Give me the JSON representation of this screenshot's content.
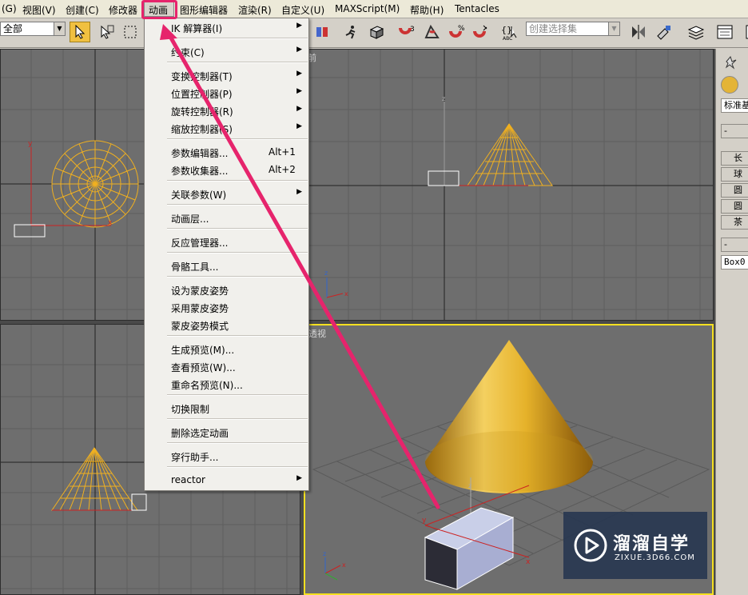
{
  "menubar": {
    "items": [
      "(G)",
      "视图(V)",
      "创建(C)",
      "修改器",
      "动画",
      "图形编辑器",
      "渲染(R)",
      "自定义(U)",
      "MAXScript(M)",
      "帮助(H)",
      "Tentacles"
    ]
  },
  "toolbar": {
    "filter_value": "全部",
    "named_selection_placeholder": "创建选择集"
  },
  "animation_menu": {
    "items": [
      {
        "label": "IK 解算器(I)",
        "shortcut": "",
        "submenu": true
      },
      {
        "label": "约束(C)",
        "shortcut": "",
        "submenu": true
      },
      {
        "label": "变换控制器(T)",
        "shortcut": "",
        "submenu": true
      },
      {
        "label": "位置控制器(P)",
        "shortcut": "",
        "submenu": true
      },
      {
        "label": "旋转控制器(R)",
        "shortcut": "",
        "submenu": true
      },
      {
        "label": "缩放控制器(S)",
        "shortcut": "",
        "submenu": true
      },
      {
        "label": "参数编辑器...",
        "shortcut": "Alt+1",
        "submenu": false
      },
      {
        "label": "参数收集器...",
        "shortcut": "Alt+2",
        "submenu": false
      },
      {
        "label": "关联参数(W)",
        "shortcut": "",
        "submenu": true
      },
      {
        "label": "动画层...",
        "shortcut": "",
        "submenu": false
      },
      {
        "label": "反应管理器...",
        "shortcut": "",
        "submenu": false
      },
      {
        "label": "骨骼工具...",
        "shortcut": "",
        "submenu": false
      },
      {
        "label": "设为蒙皮姿势",
        "shortcut": "",
        "submenu": false
      },
      {
        "label": "采用蒙皮姿势",
        "shortcut": "",
        "submenu": false
      },
      {
        "label": "蒙皮姿势模式",
        "shortcut": "",
        "submenu": false
      },
      {
        "label": "生成预览(M)...",
        "shortcut": "",
        "submenu": false
      },
      {
        "label": "查看预览(W)...",
        "shortcut": "",
        "submenu": false
      },
      {
        "label": "重命名预览(N)...",
        "shortcut": "",
        "submenu": false
      },
      {
        "label": "切换限制",
        "shortcut": "",
        "submenu": false
      },
      {
        "label": "删除选定动画",
        "shortcut": "",
        "submenu": false
      },
      {
        "label": "穿行助手...",
        "shortcut": "",
        "submenu": false
      },
      {
        "label": "reactor",
        "shortcut": "",
        "submenu": true
      }
    ]
  },
  "viewports": {
    "front_label": "前",
    "perspective_label": "透视"
  },
  "command_panel": {
    "dropdown": "标准基",
    "buttons": [
      "长",
      "球",
      "圆",
      "圆",
      "茶"
    ],
    "name_field": "Box0",
    "rollout_minus": "-"
  },
  "watermark": {
    "title": "溜溜自学",
    "url": "ZIXUE.3D66.COM"
  },
  "colors": {
    "wireframe": "#f0b020",
    "highlight": "#e6246c",
    "viewport_bg": "#6e6e6e",
    "active_border": "#f5e020"
  }
}
